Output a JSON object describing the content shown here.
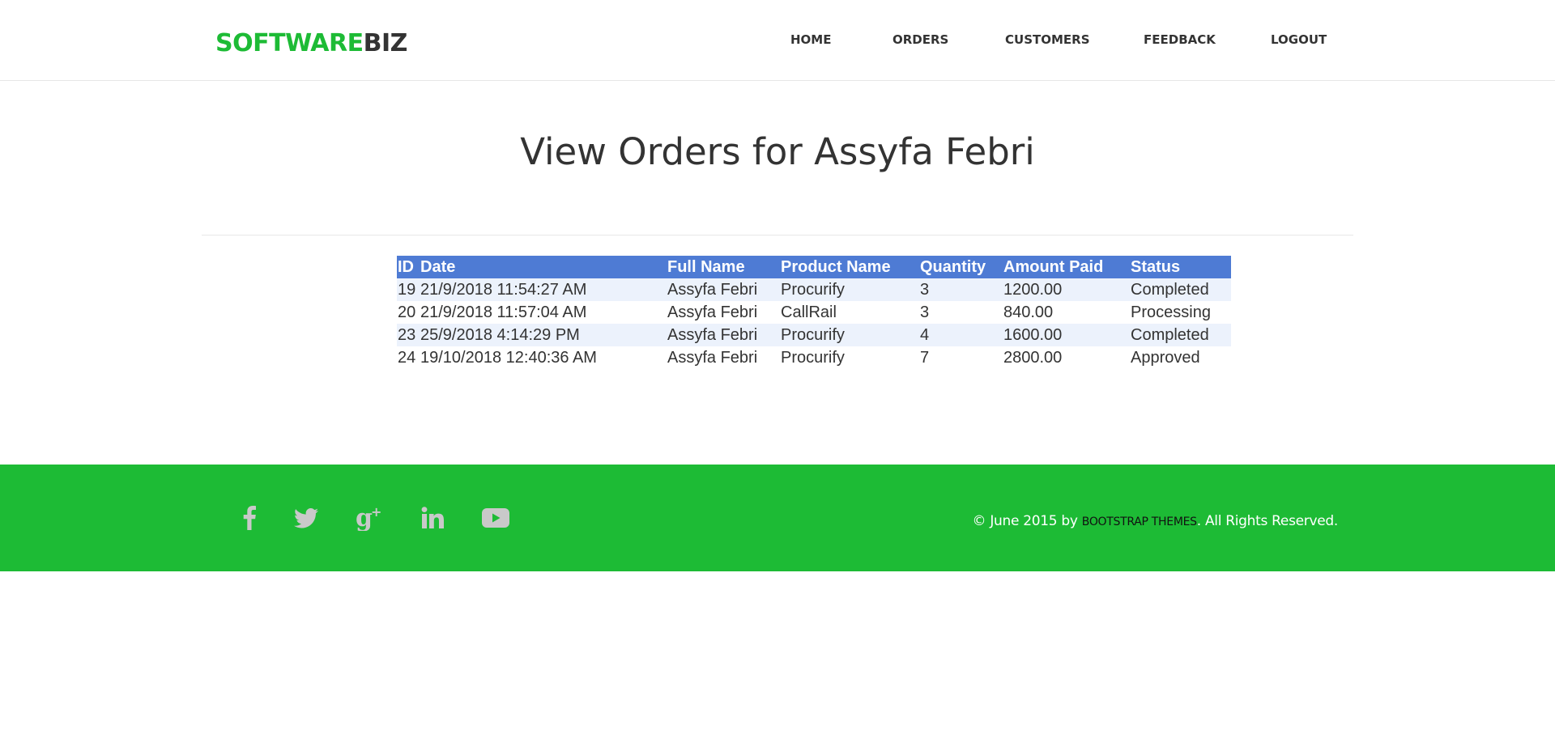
{
  "brand": {
    "part1": "SOFTWARE",
    "part2": "BIZ"
  },
  "nav": {
    "home": "HOME",
    "orders": "ORDERS",
    "customers": "CUSTOMERS",
    "feedback": "FEEDBACK",
    "logout": "LOGOUT"
  },
  "main": {
    "title": "View Orders for Assyfa Febri"
  },
  "orders_table": {
    "headers": {
      "id": "ID",
      "date": "Date",
      "full_name": "Full Name",
      "product_name": "Product Name",
      "quantity": "Quantity",
      "amount_paid": "Amount Paid",
      "status": "Status"
    },
    "rows": [
      {
        "id": "19",
        "date": "21/9/2018 11:54:27 AM",
        "full_name": "Assyfa Febri",
        "product_name": "Procurify",
        "quantity": "3",
        "amount_paid": "1200.00",
        "status": "Completed"
      },
      {
        "id": "20",
        "date": "21/9/2018 11:57:04 AM",
        "full_name": "Assyfa Febri",
        "product_name": "CallRail",
        "quantity": "3",
        "amount_paid": "840.00",
        "status": "Processing"
      },
      {
        "id": "23",
        "date": "25/9/2018 4:14:29 PM",
        "full_name": "Assyfa Febri",
        "product_name": "Procurify",
        "quantity": "4",
        "amount_paid": "1600.00",
        "status": "Completed"
      },
      {
        "id": "24",
        "date": "19/10/2018 12:40:36 AM",
        "full_name": "Assyfa Febri",
        "product_name": "Procurify",
        "quantity": "7",
        "amount_paid": "2800.00",
        "status": "Approved"
      }
    ]
  },
  "footer": {
    "social_icons": [
      "facebook-icon",
      "twitter-icon",
      "google-plus-icon",
      "linkedin-icon",
      "youtube-icon"
    ],
    "copyright_prefix": "© June 2015 by ",
    "copyright_link": "BOOTSTRAP THEMES",
    "copyright_suffix": ". All Rights Reserved."
  },
  "colors": {
    "brand_green": "#1dbb35",
    "table_header_blue": "#4e7bd4",
    "row_stripe": "#ecf2fc",
    "social_icon": "#c9c9c9"
  }
}
